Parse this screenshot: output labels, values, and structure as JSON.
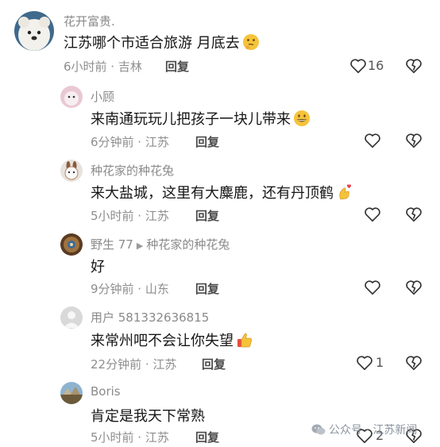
{
  "comments": [
    {
      "author": "花开富贵.",
      "text": "江苏哪个市适合旅游 月底去",
      "emoji": "thinking-face-emoji",
      "meta": "6小时前 · 吉林",
      "reply": "回复",
      "likes": "16"
    },
    {
      "author": "小顾",
      "text": "来南通玩玩儿把孩子一块儿带来",
      "emoji": "grinning-face-emoji",
      "meta": "6分钟前 · 江苏",
      "reply": "回复",
      "likes": ""
    },
    {
      "author": "种花家的种花兔",
      "text": "来大盐城，这里有大麋鹿，还有丹顶鹤",
      "emoji": "finger-heart-emoji",
      "meta": "5小时前 · 江苏",
      "reply": "回复",
      "likes": ""
    },
    {
      "author": "野生 77",
      "reply_to": "种花家的种花兔",
      "text": "好",
      "meta": "9分钟前 · 山东",
      "reply": "回复",
      "likes": ""
    },
    {
      "author": "用户 581332636815",
      "text": "来常州吧不会让你失望",
      "emoji": "thumbs-up-emoji",
      "meta": "22分钟前 · 江苏",
      "reply": "回复",
      "likes": "1"
    },
    {
      "author": "Boris",
      "text": "肯定是我天下常熟",
      "meta": "5小时前 · 江苏",
      "reply": "回复",
      "likes": "2"
    }
  ],
  "watermark": "公众号 · 江苏新闻",
  "colors": {
    "meta_gray": "#8e8e8e",
    "text": "#161616",
    "emoji_yellow": "#f5c33b"
  }
}
